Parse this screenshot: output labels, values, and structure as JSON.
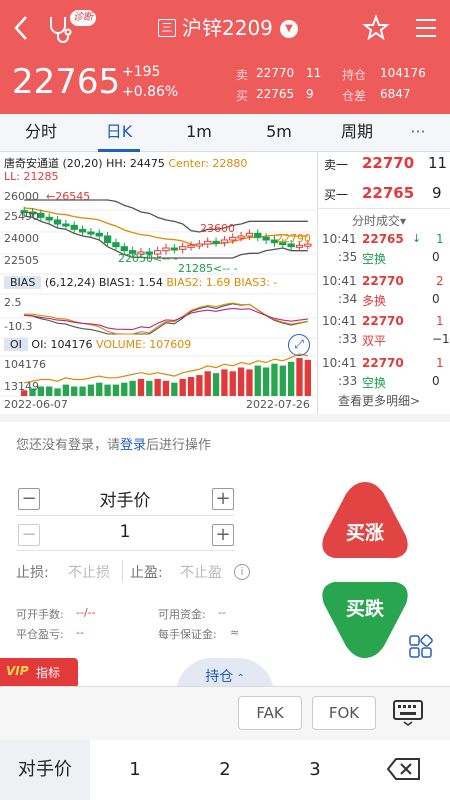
{
  "header": {
    "title": "沪锌2209",
    "diag_badge": "诊断",
    "price": "22765",
    "change": "+195",
    "change_pct": "+0.86%",
    "ask_label": "卖",
    "ask_price": "22770",
    "ask_vol": "11",
    "bid_label": "买",
    "bid_price": "22765",
    "bid_vol": "9",
    "oi_label": "持仓",
    "oi_value": "104176",
    "oi_diff_label": "仓差",
    "oi_diff_value": "6847"
  },
  "tabs": [
    "分时",
    "日K",
    "1m",
    "5m",
    "周期",
    "···"
  ],
  "chart": {
    "legend_name": "唐奇安通道 (20,20)",
    "hh": "HH: 24475",
    "center": "Center: 22880",
    "ll": "LL: 21285",
    "y_labels": [
      "26545",
      "26000",
      "25490",
      "24000",
      "22505",
      "22505"
    ],
    "ann_high": "←26545",
    "ann_mid": "23600",
    "ann_right": "22790",
    "ann_low": "22050<-- -",
    "ann_ll": "21285<-- -",
    "bias_label": "BIAS",
    "bias_params": "(6,12,24)",
    "bias1": "BIAS1: 1.54",
    "bias2": "BIAS2: 1.69",
    "bias3": "BIAS3: -",
    "bias_top": "2.5",
    "bias_bot": "-10.3",
    "oi_label": "OI",
    "oi_val": "OI: 104176",
    "volume": "VOLUME: 107609",
    "vol_top": "104176",
    "vol_bot": "13149",
    "date_start": "2022-06-07",
    "date_end": "2022-07-26"
  },
  "orderbook": {
    "ask_label": "卖一",
    "ask_price": "22770",
    "ask_vol": "11",
    "bid_label": "买一",
    "bid_price": "22765",
    "bid_vol": "9"
  },
  "ticks_title": "分时成交▾",
  "ticks": [
    {
      "t1": "10:41",
      "t2": ":35",
      "price": "22765",
      "arrow": "↓",
      "vol": "1",
      "type": "空换",
      "oi": "0"
    },
    {
      "t1": "10:41",
      "t2": ":34",
      "price": "22770",
      "arrow": "",
      "vol": "2",
      "type": "多换",
      "oi": "0"
    },
    {
      "t1": "10:41",
      "t2": ":33",
      "price": "22770",
      "arrow": "",
      "vol": "1",
      "type": "双平",
      "oi": "−1"
    },
    {
      "t1": "10:41",
      "t2": ":33",
      "price": "22770",
      "arrow": "",
      "vol": "1",
      "type": "空换",
      "oi": "0"
    }
  ],
  "more_detail": "查看更多明细>",
  "login_prefix": "您还没有登录，请",
  "login_link": "登录",
  "login_suffix": "后进行操作",
  "price_mode": "对手价",
  "qty": "1",
  "stop_loss": "止损:",
  "stop_loss_ph": "不止损",
  "take_profit": "止盈:",
  "take_profit_ph": "不止盈",
  "buy_label": "买涨",
  "sell_label": "买跌",
  "info": {
    "can_open": "可开手数:",
    "can_open_val": "--/--",
    "avail": "可用资金:",
    "avail_val": "--",
    "close_pl": "平仓盈亏:",
    "close_pl_val": "--",
    "margin": "每手保证金:",
    "margin_val": "≈"
  },
  "vip": "指标",
  "position_tab": "持仓",
  "fak": "FAK",
  "fok": "FOK",
  "keys": [
    "对手价",
    "1",
    "2",
    "3"
  ],
  "colors": {
    "header": "#ee5b5b",
    "up": "#e23a3a",
    "down": "#1aa04a"
  },
  "chart_data": {
    "type": "bar",
    "volume": [
      3,
      4,
      5,
      5,
      4,
      6,
      5,
      5,
      6,
      7,
      6,
      6,
      7,
      8,
      9,
      8,
      9,
      8,
      7,
      9,
      10,
      11,
      13,
      12,
      14,
      13,
      15,
      14,
      16,
      15,
      17,
      16,
      18,
      20,
      19
    ],
    "closes": [
      25200,
      25100,
      24800,
      24600,
      24300,
      24200,
      23900,
      23700,
      23600,
      23400,
      22900,
      22600,
      22300,
      22100,
      22200,
      22050,
      22300,
      22500,
      22400,
      22600,
      22700,
      22800,
      23000,
      22900,
      23100,
      23300,
      23400,
      23600,
      23300,
      23100,
      22900,
      22800,
      22600,
      22700,
      22790
    ],
    "ylim": [
      21000,
      27000
    ]
  }
}
